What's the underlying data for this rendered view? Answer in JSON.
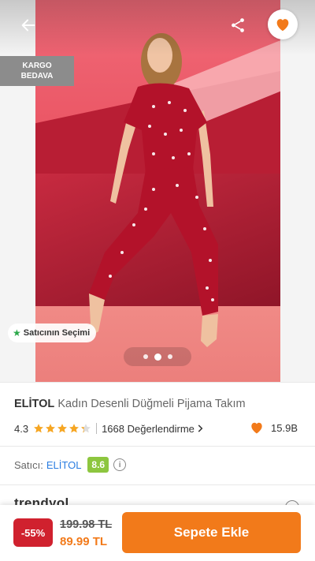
{
  "gallery": {
    "cargo_badge": "KARGO\nBEDAVA",
    "seller_choice": "Satıcının Seçimi",
    "slide_count": 3,
    "active_slide": 2
  },
  "product": {
    "brand": "ELİTOL",
    "name": "Kadın Desenli Düğmeli Pijama Takım",
    "rating": "4.3",
    "rating_value": 4.3,
    "reviews": "1668 Değerlendirme",
    "favorites": "15.9B"
  },
  "seller": {
    "label": "Satıcı:",
    "name": "ELİTOL",
    "score": "8.6"
  },
  "partial_section_text": "trendyol",
  "bottom_bar": {
    "discount": "-55%",
    "old_price": "199.98 TL",
    "new_price": "89.99 TL",
    "add_to_cart": "Sepete Ekle"
  },
  "colors": {
    "accent": "#f27a1a",
    "discount": "#d0212e",
    "seller_link": "#2a7de1",
    "seller_score": "#8dc63f",
    "star": "#f6a623"
  }
}
